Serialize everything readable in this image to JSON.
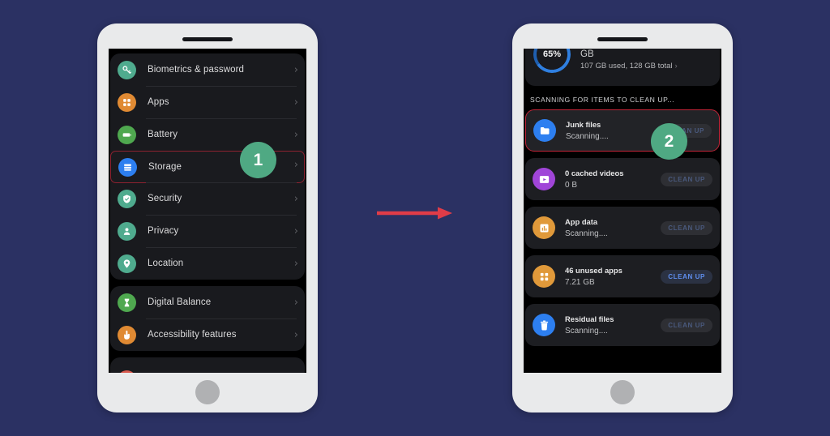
{
  "background_color": "#2b3163",
  "accent_colors": {
    "badge_green": "#4fa983",
    "arrow_red": "#e03c48",
    "highlight_border_left": "#8e2230",
    "highlight_border_right": "#c02538",
    "active_button_blue": "#5f8ff0"
  },
  "flow": {
    "arrow_label": "step-flow-arrow"
  },
  "badges": [
    {
      "number": "1",
      "target": "Storage"
    },
    {
      "number": "2",
      "target": "Junk files"
    }
  ],
  "left_phone": {
    "name": "settings-screen",
    "groups": [
      {
        "items": [
          {
            "label": "Biometrics & password",
            "icon": "key-icon",
            "icon_color": "#4fab8e",
            "chevron": "›"
          },
          {
            "label": "Apps",
            "icon": "apps-grid-icon",
            "icon_color": "#e08a33",
            "chevron": "›"
          },
          {
            "label": "Battery",
            "icon": "battery-icon",
            "icon_color": "#4fa84f",
            "chevron": "›"
          },
          {
            "label": "Storage",
            "icon": "storage-icon",
            "icon_color": "#2d7ff0",
            "chevron": "›",
            "highlighted": true
          },
          {
            "label": "Security",
            "icon": "shield-check-icon",
            "icon_color": "#4fab8e",
            "chevron": "›"
          },
          {
            "label": "Privacy",
            "icon": "person-lock-icon",
            "icon_color": "#4fab8e",
            "chevron": "›"
          },
          {
            "label": "Location",
            "icon": "location-pin-icon",
            "icon_color": "#4fab8e",
            "chevron": "›"
          }
        ]
      },
      {
        "items": [
          {
            "label": "Digital Balance",
            "icon": "hourglass-icon",
            "icon_color": "#4fa84f",
            "chevron": "›"
          },
          {
            "label": "Accessibility features",
            "icon": "hand-touch-icon",
            "icon_color": "#e08a33",
            "chevron": "›"
          }
        ]
      }
    ]
  },
  "right_phone": {
    "name": "storage-cleanup-screen",
    "storage_summary": {
      "percent_label": "65%",
      "percent_value": 65,
      "unit_label": "GB",
      "detail": "107 GB used, 128 GB total",
      "chevron": "›"
    },
    "section_title": "SCANNING FOR ITEMS TO CLEAN UP...",
    "items": [
      {
        "title": "Junk files",
        "subtitle": "Scanning....",
        "icon": "folder-icon",
        "icon_color": "#2d7ff0",
        "button_label": "CLEAN UP",
        "button_active": false,
        "highlighted": true
      },
      {
        "title": "0 cached videos",
        "subtitle": "0 B",
        "icon": "video-thumbnail-icon",
        "icon_color": "#a045d8",
        "button_label": "CLEAN UP",
        "button_active": false,
        "highlighted": false
      },
      {
        "title": "App data",
        "subtitle": "Scanning....",
        "icon": "chart-bars-icon",
        "icon_color": "#e0993a",
        "button_label": "CLEAN UP",
        "button_active": false,
        "highlighted": false
      },
      {
        "title": "46 unused apps",
        "subtitle": "7.21 GB",
        "icon": "apps-grid-icon",
        "icon_color": "#e0993a",
        "button_label": "CLEAN UP",
        "button_active": true,
        "highlighted": false
      },
      {
        "title": "Residual files",
        "subtitle": "Scanning....",
        "icon": "trash-icon",
        "icon_color": "#2d7ff0",
        "button_label": "CLEAN UP",
        "button_active": false,
        "highlighted": false
      }
    ]
  }
}
